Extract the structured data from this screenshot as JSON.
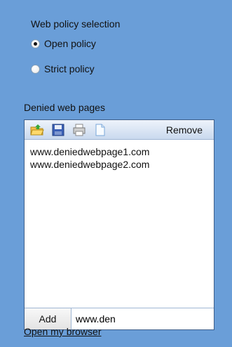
{
  "policy": {
    "heading": "Web policy selection",
    "options": [
      {
        "label": "Open policy",
        "checked": true
      },
      {
        "label": "Strict policy",
        "checked": false
      }
    ]
  },
  "denied": {
    "title": "Denied web pages",
    "toolbar": {
      "icons": [
        "open-folder-icon",
        "save-icon",
        "print-icon",
        "new-document-icon"
      ],
      "remove_label": "Remove"
    },
    "entries": [
      "www.deniedwebpage1.com",
      "www.deniedwebpage2.com"
    ],
    "add_label": "Add",
    "input_value": "www.den"
  },
  "link": {
    "label": "Open my browser"
  }
}
